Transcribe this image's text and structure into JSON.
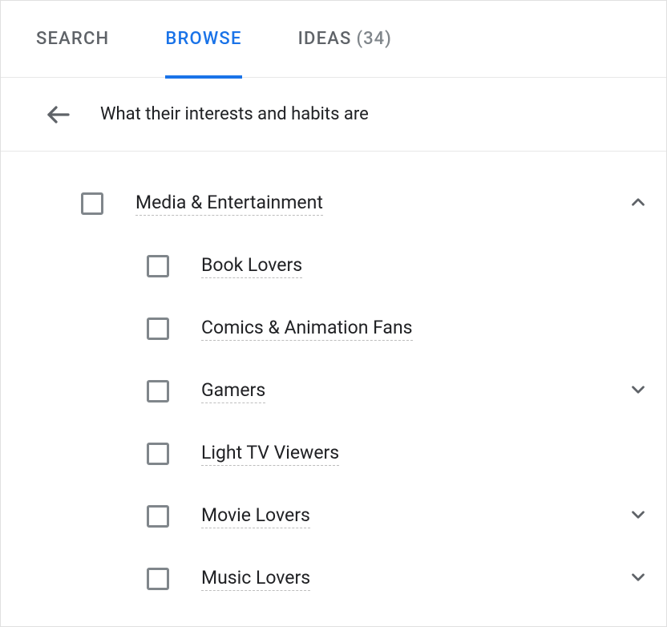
{
  "tabs": {
    "search": "SEARCH",
    "browse": "BROWSE",
    "ideas_label": "IDEAS",
    "ideas_count": "(34)"
  },
  "header": {
    "title": "What their interests and habits are"
  },
  "colors": {
    "accent": "#1a73e8",
    "text": "#202124",
    "muted": "#5f6368"
  },
  "category": {
    "label": "Media & Entertainment",
    "expanded": true,
    "children": [
      {
        "label": "Book Lovers",
        "expandable": false
      },
      {
        "label": "Comics & Animation Fans",
        "expandable": false
      },
      {
        "label": "Gamers",
        "expandable": true
      },
      {
        "label": "Light TV Viewers",
        "expandable": false
      },
      {
        "label": "Movie Lovers",
        "expandable": true
      },
      {
        "label": "Music Lovers",
        "expandable": true
      }
    ]
  }
}
